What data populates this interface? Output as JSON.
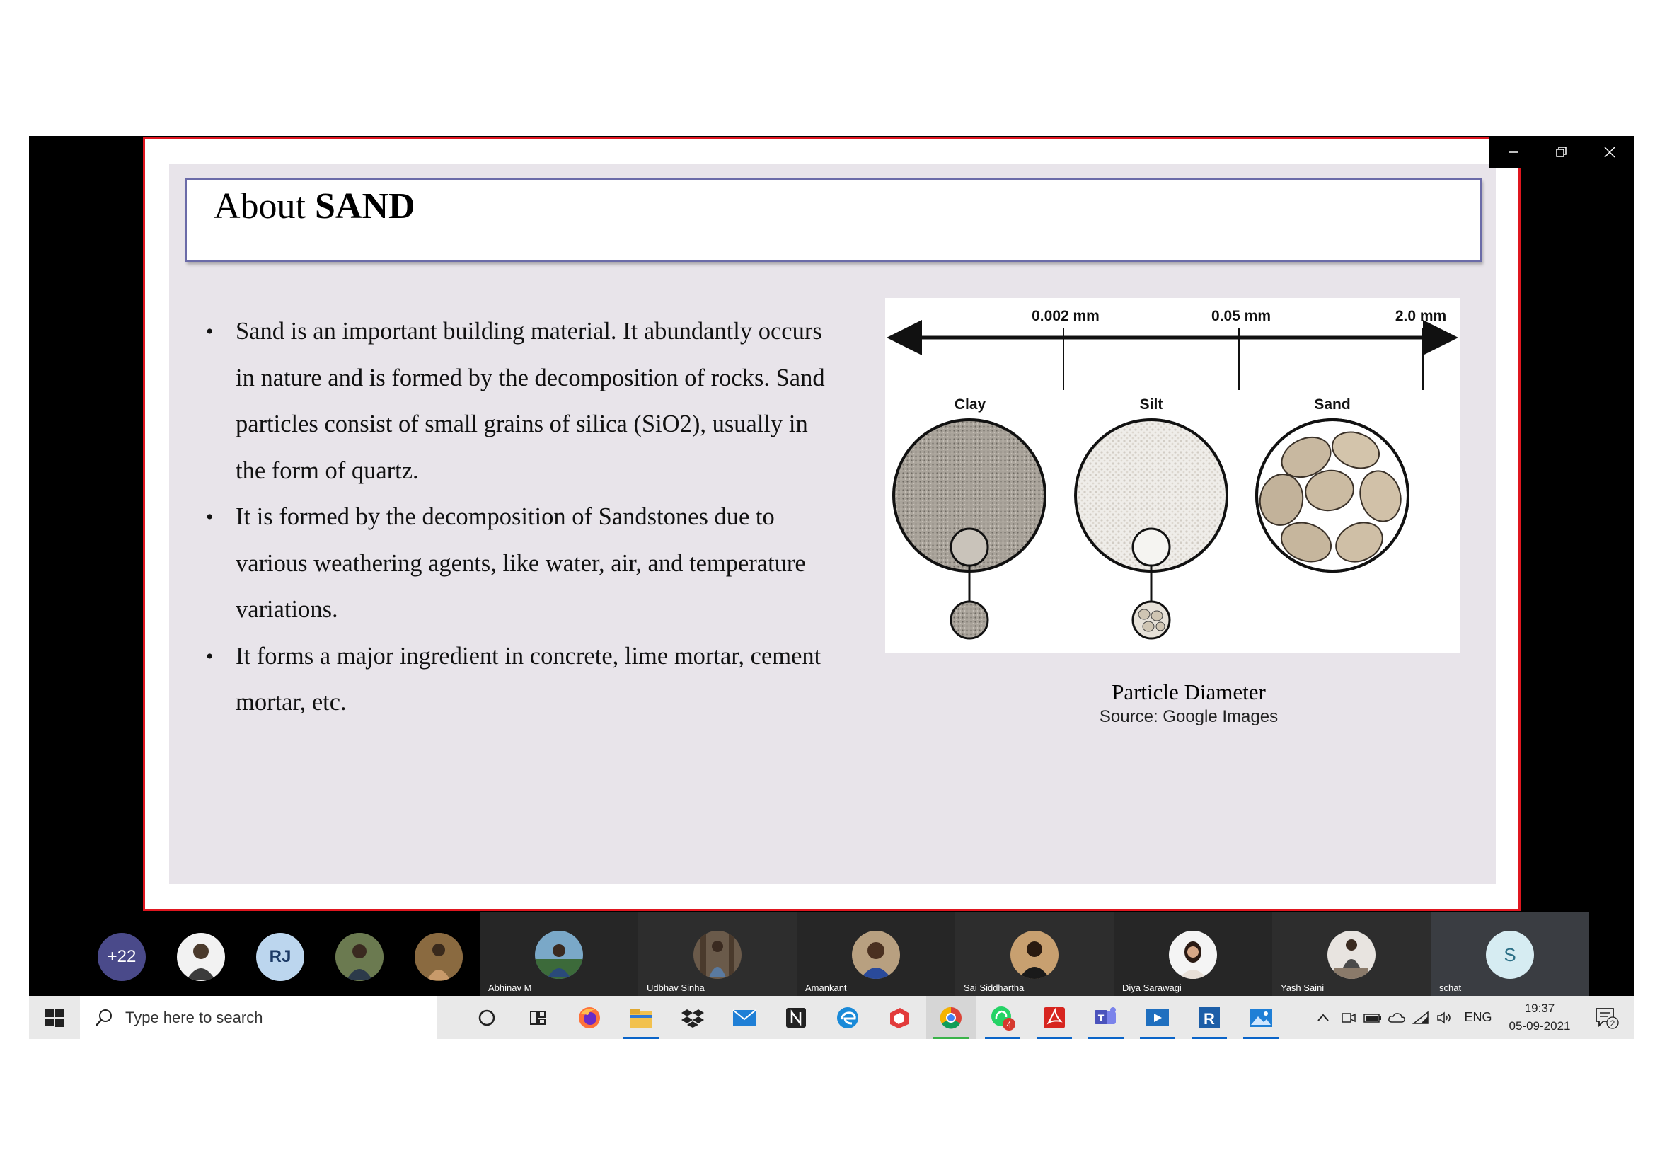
{
  "slide": {
    "title_prefix": "About ",
    "title_bold": "SAND",
    "bullets": [
      "Sand is an important building material. It abundantly occurs in nature and is formed by the decomposition of rocks. Sand particles consist of small grains of silica (SiO2), usually in the form of quartz.",
      "It is formed by the decomposition of Sandstones due to various weathering agents, like water, air, and temperature variations.",
      "It forms a major ingredient in concrete, lime mortar, cement mortar, etc."
    ],
    "figure": {
      "scale_labels": [
        "0.002 mm",
        "0.05 mm",
        "2.0 mm"
      ],
      "particles": [
        "Clay",
        "Silt",
        "Sand"
      ],
      "caption": "Particle Diameter",
      "source": "Source: Google Images"
    }
  },
  "participants": {
    "overflow_count": "+22",
    "initials_avatar": "RJ",
    "tiles": [
      {
        "name": "Abhinav M"
      },
      {
        "name": "Udbhav Sinha"
      },
      {
        "name": "Amankant"
      },
      {
        "name": "Sai Siddhartha"
      },
      {
        "name": "Diya Sarawagi"
      },
      {
        "name": "Yash Saini"
      },
      {
        "name": "schat",
        "initial": "S"
      }
    ]
  },
  "taskbar": {
    "search_placeholder": "Type here to search",
    "apps": [
      "cortana-icon",
      "task-view-icon",
      "firefox-icon",
      "file-explorer-icon",
      "dropbox-icon",
      "mail-icon",
      "notion-icon",
      "edge-icon",
      "sketchup-icon",
      "chrome-icon",
      "whatsapp-icon",
      "acrobat-icon",
      "teams-icon",
      "media-player-icon",
      "revit-icon",
      "photos-icon"
    ],
    "whatsapp_badge": "4",
    "language": "ENG",
    "time": "19:37",
    "date": "05-09-2021",
    "notifications": "2"
  },
  "colors": {
    "share_border": "#e0161f",
    "slide_bg": "#e8e4ea",
    "title_border": "#6b6ba8",
    "taskbar_bg": "#e9e9e9"
  }
}
